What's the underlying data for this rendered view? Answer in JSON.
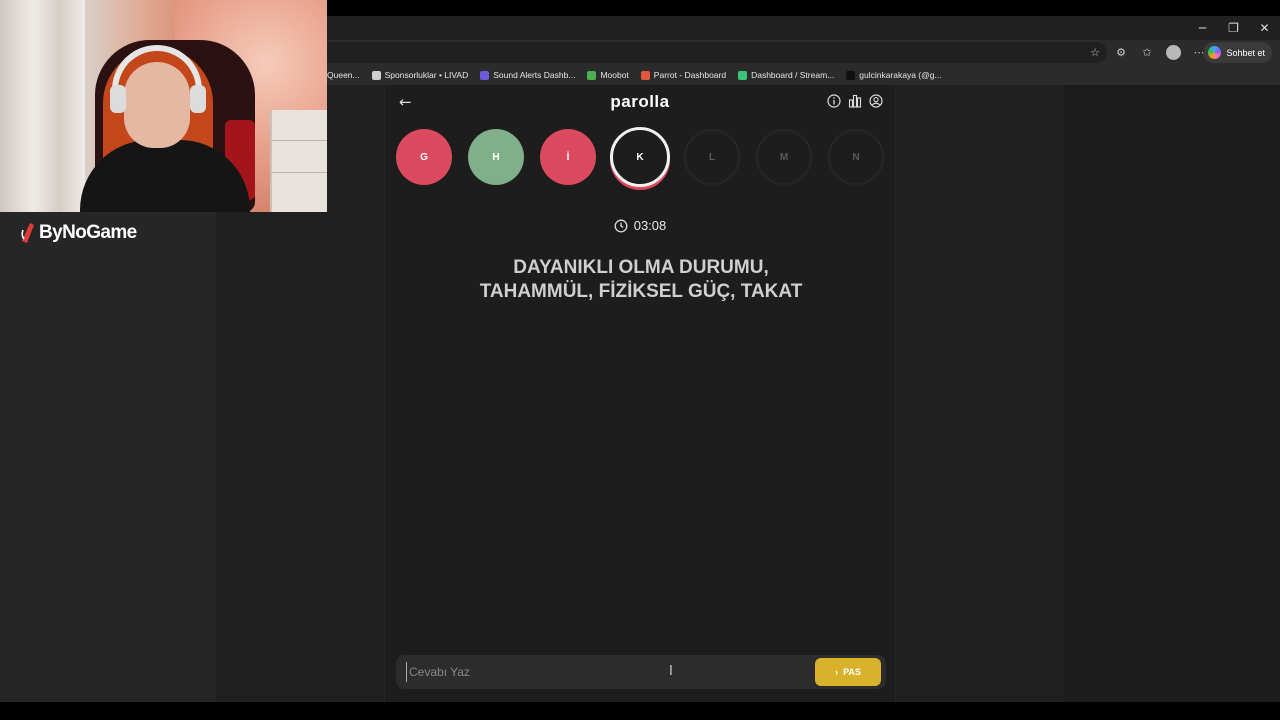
{
  "browser": {
    "window_controls": {
      "minimize": "─",
      "restore": "❐",
      "close": "✕"
    },
    "toolbar": {
      "chat_button_label": "Sohbet et"
    },
    "bookmarks": [
      {
        "label": "Queen...",
        "color": "#2b2b2b"
      },
      {
        "label": "Sponsorluklar • LIVAD",
        "color": "#cfcfcf"
      },
      {
        "label": "Sound Alerts Dashb...",
        "color": "#6b5bd6"
      },
      {
        "label": "Moobot",
        "color": "#4caf50"
      },
      {
        "label": "Parrot - Dashboard",
        "color": "#e0573b"
      },
      {
        "label": "Dashboard / Stream...",
        "color": "#39c47a"
      },
      {
        "label": "gulcinkarakaya (@g...",
        "color": "#111111"
      }
    ]
  },
  "game": {
    "logo": "parolla",
    "letters": [
      {
        "char": "G",
        "status": "wrong",
        "color": "#dc4a5f"
      },
      {
        "char": "H",
        "status": "correct",
        "color": "#7fb08a"
      },
      {
        "char": "İ",
        "status": "wrong",
        "color": "#dc4a5f"
      },
      {
        "char": "K",
        "status": "active",
        "color": "#1d1d1d"
      },
      {
        "char": "L",
        "status": "pending",
        "color": "#1d1d1d"
      },
      {
        "char": "M",
        "status": "pending",
        "color": "#1d1d1d"
      },
      {
        "char": "N",
        "status": "pending",
        "color": "#1d1d1d"
      }
    ],
    "timer": "03:08",
    "question_line1": "DAYANIKLI OLMA DURUMU,",
    "question_line2": "TAHAMMÜL, FİZİKSEL GÜÇ, TAKAT",
    "answer_placeholder": "Cevabı Yaz",
    "pass_label": "PAS",
    "accent_color": "#d7b22a"
  },
  "overlay": {
    "brand": "ByNoGame"
  }
}
